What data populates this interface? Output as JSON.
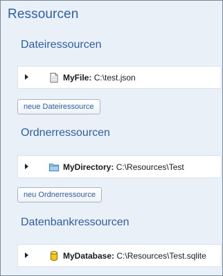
{
  "title": "Ressourcen",
  "sections": [
    {
      "heading": "Dateiressourcen",
      "item": {
        "name": "MyFile:",
        "value": "C:\\test.json",
        "icon": "file-icon"
      },
      "button": "neue Dateiressource"
    },
    {
      "heading": "Ordnerressourcen",
      "item": {
        "name": "MyDirectory:",
        "value": "C:\\Resources\\Test",
        "icon": "folder-icon"
      },
      "button": "neu Ordnerressource"
    },
    {
      "heading": "Datenbankressourcen",
      "item": {
        "name": "MyDatabase:",
        "value": "C:\\Resources\\Test.sqlite",
        "icon": "database-icon"
      }
    }
  ],
  "colors": {
    "accent": "#2d5fa8",
    "panel_background": "#eaf0f7",
    "folder": "#9fd0f2",
    "database": "#f5c814"
  }
}
